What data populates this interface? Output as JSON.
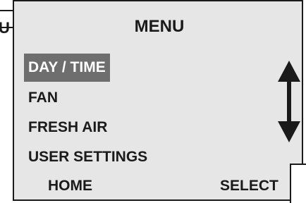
{
  "header": {
    "title": "MENU"
  },
  "background_screen": {
    "tab_label_fragment": "U"
  },
  "menu": {
    "items": [
      {
        "label": "DAY / TIME",
        "selected": true
      },
      {
        "label": "FAN",
        "selected": false
      },
      {
        "label": "FRESH AIR",
        "selected": false
      },
      {
        "label": "USER SETTINGS",
        "selected": false
      }
    ],
    "scroll_indicator_icon": "up-down-arrow"
  },
  "softkeys": {
    "left_label": "HOME",
    "right_label": "SELECT"
  },
  "colors": {
    "screen_background": "#e6e6e6",
    "highlight": "#6e6e6e",
    "text": "#1a1a1a"
  }
}
